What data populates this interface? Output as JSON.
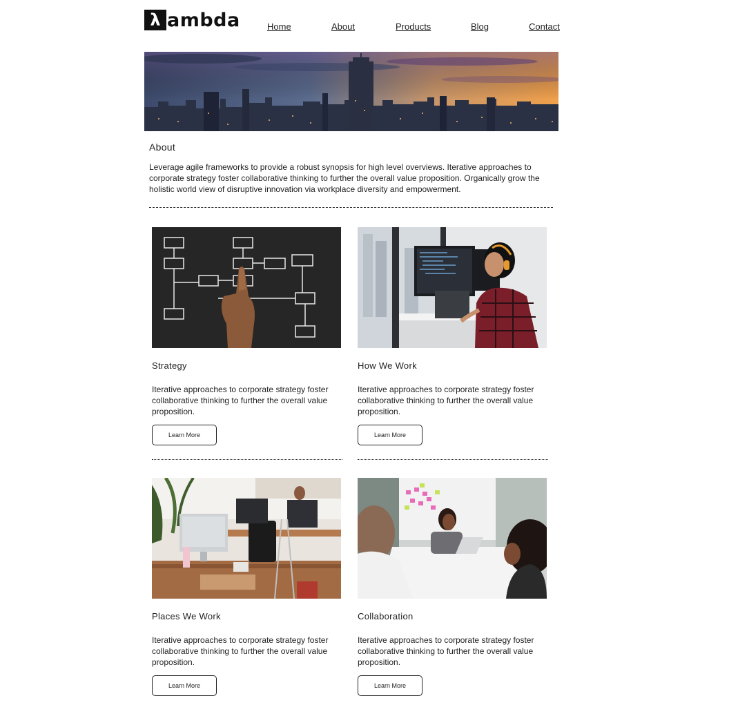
{
  "brand": {
    "logo_glyph": "λ",
    "logo_text": "ambda"
  },
  "nav": {
    "items": [
      "Home",
      "About",
      "Products",
      "Blog",
      "Contact"
    ]
  },
  "about": {
    "heading": "About",
    "text": "Leverage agile frameworks to provide a robust synopsis for high level overviews. Iterative approaches to corporate strategy foster collaborative thinking to further the overall value proposition. Organically grow the holistic world view of disruptive innovation via workplace diversity and empowerment."
  },
  "cards": [
    {
      "title": "Strategy",
      "text": "Iterative approaches to corporate strategy foster collaborative thinking to further the overall value proposition.",
      "button": "Learn More"
    },
    {
      "title": "How We Work",
      "text": "Iterative approaches to corporate strategy foster collaborative thinking to further the overall value proposition.",
      "button": "Learn More"
    },
    {
      "title": "Places We Work",
      "text": "Iterative approaches to corporate strategy foster collaborative thinking to further the overall value proposition.",
      "button": "Learn More"
    },
    {
      "title": "Collaboration",
      "text": "Iterative approaches to corporate strategy foster collaborative thinking to further the overall value proposition.",
      "button": "Learn More"
    }
  ],
  "colors": {
    "text": "#222222",
    "background": "#ffffff",
    "logo": "#111111"
  }
}
